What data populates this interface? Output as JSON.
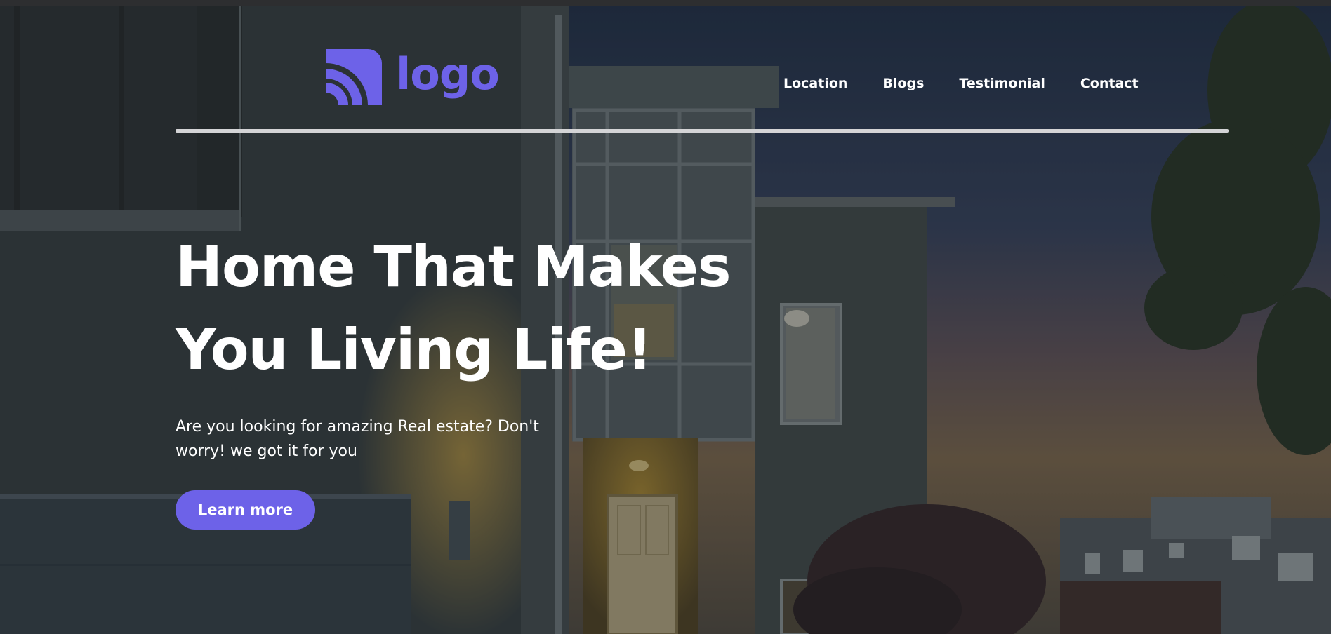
{
  "brand": {
    "logo_text": "logo",
    "accent_color": "#6d62e8",
    "logo_icon": "signal-waves-icon"
  },
  "nav": {
    "items": [
      {
        "label": "Location"
      },
      {
        "label": "Blogs"
      },
      {
        "label": "Testimonial"
      },
      {
        "label": "Contact"
      }
    ]
  },
  "hero": {
    "headline_line1": "Home That Makes",
    "headline_line2": "You Living Life!",
    "subtext_line1": "Are you looking for amazing Real estate? Don't",
    "subtext_line2": "worry! we got it for you",
    "cta_label": "Learn more",
    "background": "modern-house-at-dusk-photo"
  }
}
